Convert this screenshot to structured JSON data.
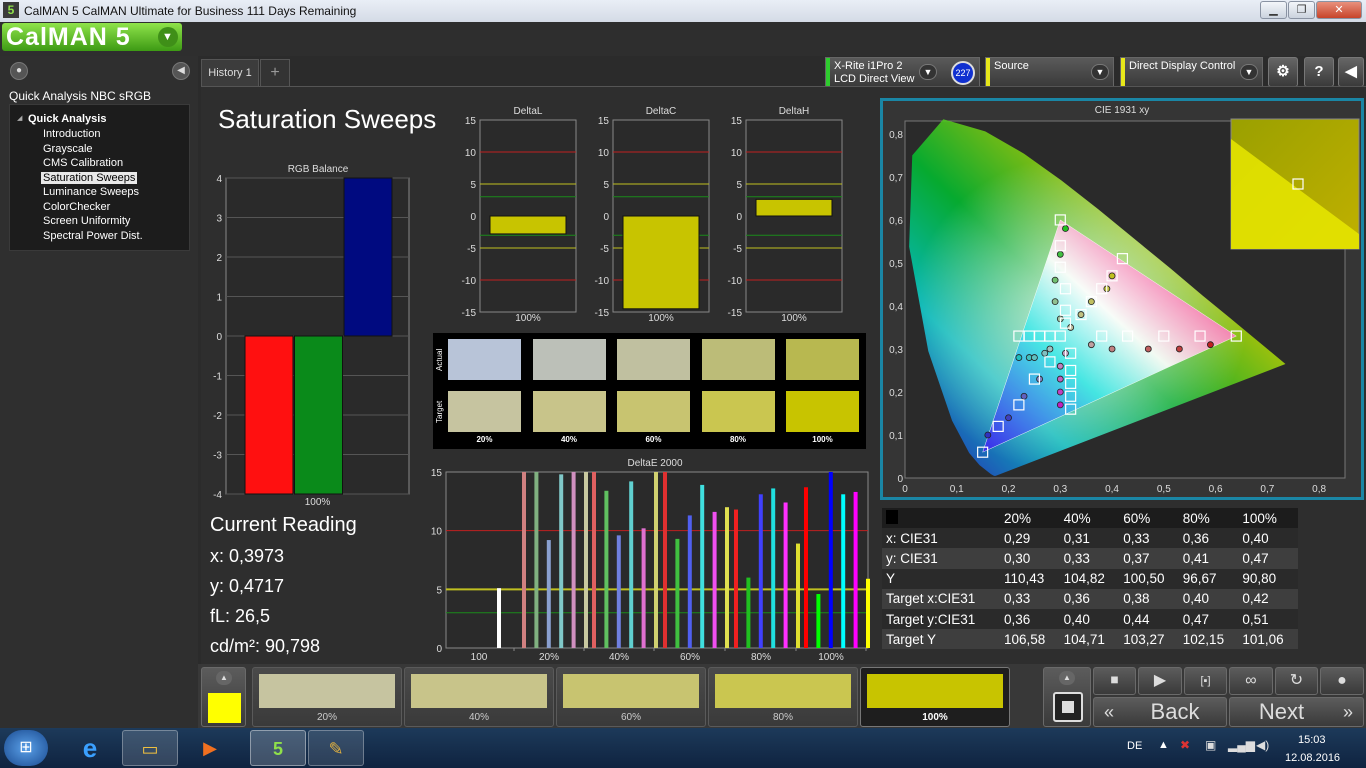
{
  "window": {
    "title": "CalMAN 5 CalMAN Ultimate for Business 111 Days Remaining",
    "app_icon": "5",
    "controls": [
      "minimize-icon",
      "maximize-icon",
      "close-icon"
    ]
  },
  "logo": {
    "text": "CalMAN 5",
    "dropdown_icon": "chevron-down-icon"
  },
  "sidebar": {
    "workflow_title": "Quick Analysis NBC sRGB",
    "tree_root": "Quick Analysis",
    "items": [
      {
        "label": "Introduction"
      },
      {
        "label": "Grayscale"
      },
      {
        "label": "CMS Calibration"
      },
      {
        "label": "Saturation Sweeps",
        "selected": true
      },
      {
        "label": "Luminance Sweeps"
      },
      {
        "label": "ColorChecker"
      },
      {
        "label": "Screen Uniformity"
      },
      {
        "label": "Spectral Power Dist."
      }
    ]
  },
  "tabs": {
    "history": "History 1",
    "add": "+"
  },
  "devices": {
    "meter_line1": "X-Rite i1Pro 2",
    "meter_line2": "LCD Direct View",
    "meter_badge": "227",
    "source": "Source",
    "display": "Direct Display Control",
    "colors": {
      "meter": "#2ecc2e",
      "source": "#e8e81a",
      "display": "#e8e81a"
    }
  },
  "page": {
    "title": "Saturation Sweeps"
  },
  "rgb_balance": {
    "title": "RGB Balance",
    "y_ticks": [
      "4",
      "3",
      "2",
      "1",
      "0",
      "-1",
      "-2",
      "-3",
      "-4"
    ],
    "x_label": "100%",
    "bars": [
      {
        "name": "red",
        "value": -4,
        "color": "#ff1010"
      },
      {
        "name": "green",
        "value": -4,
        "color": "#0a8a1a"
      },
      {
        "name": "blue",
        "value": 4,
        "color": "#000a80"
      }
    ]
  },
  "delta_charts": [
    {
      "title": "DeltaL",
      "value": -2.8,
      "x_label": "100%"
    },
    {
      "title": "DeltaC",
      "value": -14.5,
      "x_label": "100%"
    },
    {
      "title": "DeltaH",
      "value": 2.6,
      "x_label": "100%"
    }
  ],
  "delta_ticks": [
    "15",
    "10",
    "5",
    "0",
    "-5",
    "-10",
    "-15"
  ],
  "swatches": {
    "row_actual": "Actual",
    "row_target": "Target",
    "labels": [
      "20%",
      "40%",
      "60%",
      "80%",
      "100%"
    ],
    "actual": [
      "#b8c4d8",
      "#bcc0b8",
      "#c0c0a0",
      "#bcbc78",
      "#b8b850"
    ],
    "target": [
      "#c6c4a0",
      "#c8c48a",
      "#c8c470",
      "#cac650",
      "#c8c400"
    ]
  },
  "deltae": {
    "title": "DeltaE 2000",
    "y_ticks": [
      "15",
      "10",
      "5",
      "0"
    ],
    "x_labels": [
      "100",
      "20%",
      "40%",
      "60%",
      "80%",
      "100%"
    ],
    "groups": [
      {
        "label": "100",
        "bars": [
          {
            "v": 5.1,
            "c": "#ffffff"
          }
        ]
      },
      {
        "label": "20%",
        "bars": [
          {
            "v": 15,
            "c": "#d08080"
          },
          {
            "v": 15,
            "c": "#80b080"
          },
          {
            "v": 9.2,
            "c": "#8aa0d0"
          },
          {
            "v": 14.8,
            "c": "#80c8c8"
          },
          {
            "v": 15,
            "c": "#d090c0"
          },
          {
            "v": 15,
            "c": "#c8c8a0"
          }
        ]
      },
      {
        "label": "40%",
        "bars": [
          {
            "v": 15,
            "c": "#e06060"
          },
          {
            "v": 13.4,
            "c": "#60c060"
          },
          {
            "v": 9.6,
            "c": "#7080e0"
          },
          {
            "v": 14.2,
            "c": "#60d0d0"
          },
          {
            "v": 10.2,
            "c": "#e070d0"
          },
          {
            "v": 15,
            "c": "#d0d070"
          }
        ]
      },
      {
        "label": "60%",
        "bars": [
          {
            "v": 15,
            "c": "#e03030"
          },
          {
            "v": 9.3,
            "c": "#40c040"
          },
          {
            "v": 11.3,
            "c": "#5060f0"
          },
          {
            "v": 13.9,
            "c": "#40e0e0"
          },
          {
            "v": 11.6,
            "c": "#f050f0"
          },
          {
            "v": 12,
            "c": "#e0e050"
          }
        ]
      },
      {
        "label": "80%",
        "bars": [
          {
            "v": 11.8,
            "c": "#f02020"
          },
          {
            "v": 6,
            "c": "#20c020"
          },
          {
            "v": 13.1,
            "c": "#4040ff"
          },
          {
            "v": 13.6,
            "c": "#20e0e0"
          },
          {
            "v": 12.4,
            "c": "#ff30ff"
          },
          {
            "v": 8.9,
            "c": "#e0e030"
          }
        ]
      },
      {
        "label": "100%",
        "bars": [
          {
            "v": 13.7,
            "c": "#ff0000"
          },
          {
            "v": 4.6,
            "c": "#00ff00"
          },
          {
            "v": 15,
            "c": "#0000ff"
          },
          {
            "v": 13.1,
            "c": "#00ffff"
          },
          {
            "v": 13.3,
            "c": "#ff00ff"
          },
          {
            "v": 5.9,
            "c": "#ffff00"
          }
        ]
      }
    ]
  },
  "reading": {
    "heading": "Current Reading",
    "x": "x: 0,3973",
    "y": "y: 0,4717",
    "fl": "fL: 26,5",
    "cdm2": "cd/m²: 90,798"
  },
  "cie": {
    "title": "CIE 1931 xy",
    "x_ticks": [
      "0",
      "0,1",
      "0,2",
      "0,3",
      "0,4",
      "0,5",
      "0,6",
      "0,7",
      "0,8"
    ],
    "y_ticks": [
      "0,8",
      "0,7",
      "0,6",
      "0,5",
      "0,4",
      "0,3",
      "0,2",
      "0,1",
      "0"
    ],
    "gamut": [
      [
        0.64,
        0.33
      ],
      [
        0.3,
        0.6
      ],
      [
        0.15,
        0.06
      ]
    ],
    "targets": [
      [
        0.15,
        0.06
      ],
      [
        0.18,
        0.12
      ],
      [
        0.22,
        0.17
      ],
      [
        0.25,
        0.23
      ],
      [
        0.28,
        0.27
      ],
      [
        0.3,
        0.6
      ],
      [
        0.3,
        0.54
      ],
      [
        0.3,
        0.49
      ],
      [
        0.31,
        0.44
      ],
      [
        0.31,
        0.39
      ],
      [
        0.31,
        0.36
      ],
      [
        0.64,
        0.33
      ],
      [
        0.57,
        0.33
      ],
      [
        0.5,
        0.33
      ],
      [
        0.43,
        0.33
      ],
      [
        0.38,
        0.33
      ],
      [
        0.42,
        0.51
      ],
      [
        0.4,
        0.47
      ],
      [
        0.38,
        0.44
      ],
      [
        0.36,
        0.41
      ],
      [
        0.34,
        0.38
      ],
      [
        0.22,
        0.33
      ],
      [
        0.24,
        0.33
      ],
      [
        0.26,
        0.33
      ],
      [
        0.28,
        0.33
      ],
      [
        0.3,
        0.33
      ],
      [
        0.32,
        0.29
      ],
      [
        0.32,
        0.25
      ],
      [
        0.32,
        0.22
      ],
      [
        0.32,
        0.19
      ],
      [
        0.32,
        0.16
      ]
    ],
    "measured": [
      {
        "p": [
          0.16,
          0.1
        ],
        "c": "#3030c0"
      },
      {
        "p": [
          0.2,
          0.14
        ],
        "c": "#4040c0"
      },
      {
        "p": [
          0.23,
          0.19
        ],
        "c": "#6060c0"
      },
      {
        "p": [
          0.26,
          0.23
        ],
        "c": "#8080c0"
      },
      {
        "p": [
          0.31,
          0.58
        ],
        "c": "#20c020"
      },
      {
        "p": [
          0.3,
          0.52
        ],
        "c": "#40c040"
      },
      {
        "p": [
          0.29,
          0.46
        ],
        "c": "#70c070"
      },
      {
        "p": [
          0.29,
          0.41
        ],
        "c": "#90c090"
      },
      {
        "p": [
          0.3,
          0.37
        ],
        "c": "#a0c0a0"
      },
      {
        "p": [
          0.59,
          0.31
        ],
        "c": "#c02020"
      },
      {
        "p": [
          0.53,
          0.3
        ],
        "c": "#c04040"
      },
      {
        "p": [
          0.47,
          0.3
        ],
        "c": "#c06060"
      },
      {
        "p": [
          0.4,
          0.3
        ],
        "c": "#c08080"
      },
      {
        "p": [
          0.36,
          0.31
        ],
        "c": "#c0a0a0"
      },
      {
        "p": [
          0.4,
          0.47
        ],
        "c": "#c0c020"
      },
      {
        "p": [
          0.39,
          0.44
        ],
        "c": "#c0c040"
      },
      {
        "p": [
          0.36,
          0.41
        ],
        "c": "#c0c060"
      },
      {
        "p": [
          0.34,
          0.38
        ],
        "c": "#c0c080"
      },
      {
        "p": [
          0.32,
          0.35
        ],
        "c": "#c0c0a0"
      },
      {
        "p": [
          0.22,
          0.28
        ],
        "c": "#20c0c0"
      },
      {
        "p": [
          0.24,
          0.28
        ],
        "c": "#40c0c0"
      },
      {
        "p": [
          0.25,
          0.28
        ],
        "c": "#60c0c0"
      },
      {
        "p": [
          0.27,
          0.29
        ],
        "c": "#80c0c0"
      },
      {
        "p": [
          0.28,
          0.3
        ],
        "c": "#a0c0c0"
      },
      {
        "p": [
          0.3,
          0.17
        ],
        "c": "#c020c0"
      },
      {
        "p": [
          0.3,
          0.2
        ],
        "c": "#c040c0"
      },
      {
        "p": [
          0.3,
          0.23
        ],
        "c": "#c060c0"
      },
      {
        "p": [
          0.3,
          0.26
        ],
        "c": "#c080c0"
      },
      {
        "p": [
          0.31,
          0.29
        ],
        "c": "#c0a0c0"
      }
    ]
  },
  "table": {
    "headers": [
      "",
      "20%",
      "40%",
      "60%",
      "80%",
      "100%"
    ],
    "rows": [
      [
        "x: CIE31",
        "0,29",
        "0,31",
        "0,33",
        "0,36",
        "0,40"
      ],
      [
        "y: CIE31",
        "0,30",
        "0,33",
        "0,37",
        "0,41",
        "0,47"
      ],
      [
        "Y",
        "110,43",
        "104,82",
        "100,50",
        "96,67",
        "90,80"
      ],
      [
        "Target x:CIE31",
        "0,33",
        "0,36",
        "0,38",
        "0,40",
        "0,42"
      ],
      [
        "Target y:CIE31",
        "0,36",
        "0,40",
        "0,44",
        "0,47",
        "0,51"
      ],
      [
        "Target Y",
        "106,58",
        "104,71",
        "103,27",
        "102,15",
        "101,06"
      ]
    ]
  },
  "bottom": {
    "active_color": "#ffff00",
    "swatches": [
      {
        "label": "20%",
        "color": "#c6c4a0"
      },
      {
        "label": "40%",
        "color": "#c8c48a"
      },
      {
        "label": "60%",
        "color": "#c8c470"
      },
      {
        "label": "80%",
        "color": "#cac650"
      },
      {
        "label": "100%",
        "color": "#c8c400"
      }
    ],
    "back": "Back",
    "next": "Next"
  },
  "taskbar": {
    "lang": "DE",
    "time": "15:03",
    "date": "12.08.2016"
  }
}
